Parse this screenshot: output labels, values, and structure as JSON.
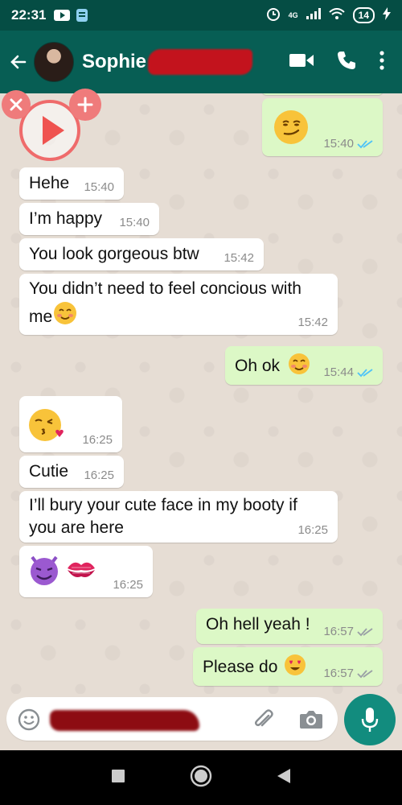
{
  "status_bar": {
    "time": "22:31",
    "network": "4G",
    "battery": "14"
  },
  "header": {
    "contact_name": "Sophie"
  },
  "messages": [
    {
      "dir": "out",
      "text": "",
      "emoji": "smirking-face-emoji",
      "time": "15:40",
      "status": "read"
    },
    {
      "dir": "in",
      "text": "Hehe",
      "time": "15:40"
    },
    {
      "dir": "in",
      "text": "I’m happy",
      "time": "15:40"
    },
    {
      "dir": "in",
      "text": "You look gorgeous btw",
      "time": "15:42"
    },
    {
      "dir": "in",
      "text_line1": "You didn’t need to feel concious with",
      "text_line2": "me",
      "emoji": "smiling-face-emoji",
      "time": "15:42"
    },
    {
      "dir": "out",
      "text": "Oh ok",
      "emoji": "smiling-face-emoji",
      "time": "15:44",
      "status": "read"
    },
    {
      "dir": "in",
      "text": "",
      "emoji": "face-blowing-kiss-emoji",
      "time": "16:25"
    },
    {
      "dir": "in",
      "text": "Cutie",
      "time": "16:25"
    },
    {
      "dir": "in",
      "text_line1": "I’ll bury your cute face in my booty if",
      "text_line2": "you are here",
      "time": "16:25"
    },
    {
      "dir": "in",
      "text": "",
      "emoji": "devil-and-kiss-mark-emoji",
      "time": "16:25"
    },
    {
      "dir": "out",
      "text": "Oh hell yeah !",
      "time": "16:57",
      "status": "delivered"
    },
    {
      "dir": "out",
      "text": "Please do",
      "emoji": "heart-eyes-emoji",
      "time": "16:57",
      "status": "delivered"
    }
  ],
  "colors": {
    "header": "#075e54",
    "status_bar": "#054d44",
    "outgoing": "#dcf8c6",
    "incoming": "#ffffff",
    "chat_bg": "#e6ddd4",
    "read_tick": "#4fc3f7",
    "accent": "#128c7e"
  }
}
